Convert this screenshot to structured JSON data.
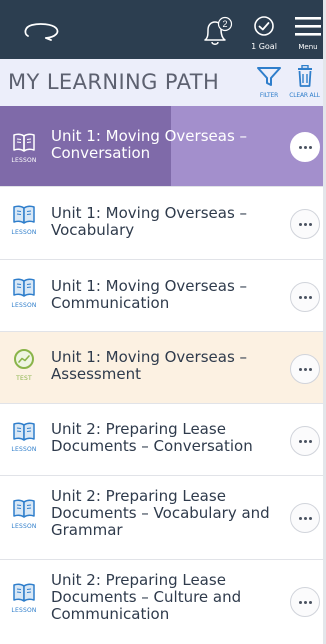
{
  "header": {
    "notification_count": "2",
    "goal_label": "1 Goal",
    "menu_label": "Menu"
  },
  "toolbar": {
    "title": "MY LEARNING PATH",
    "filter_label": "FILTER",
    "clear_all_label": "CLEAR ALL"
  },
  "items": [
    {
      "type": "LESSON",
      "text": "Unit 1: Moving Overseas – Conversation",
      "progress": 0.53,
      "selected": true
    },
    {
      "type": "LESSON",
      "text": "Unit 1: Moving Overseas – Vocabulary"
    },
    {
      "type": "LESSON",
      "text": "Unit 1: Moving Overseas – Communication"
    },
    {
      "type": "TEST",
      "text": "Unit 1: Moving Overseas – Assessment"
    },
    {
      "type": "LESSON",
      "text": "Unit 2: Preparing Lease Documents – Conversation"
    },
    {
      "type": "LESSON",
      "text": "Unit 2: Preparing Lease Documents – Vocabulary and Grammar"
    },
    {
      "type": "LESSON",
      "text": "Unit 2: Preparing Lease Documents – Culture and Communication"
    }
  ],
  "colors": {
    "header_bg": "#2c3e50",
    "accent_blue": "#2f7ecb",
    "selected_bg": "#a38fcc",
    "selected_progress": "#7f6aa9",
    "test_bg": "#fcf1e2",
    "test_green": "#8ab44a"
  }
}
